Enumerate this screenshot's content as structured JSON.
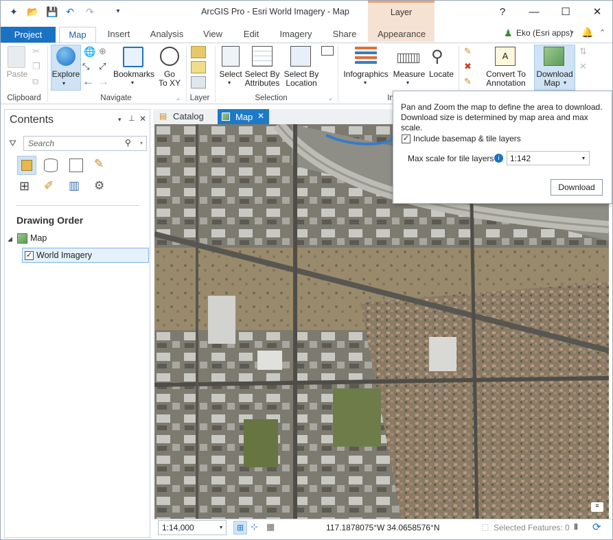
{
  "titlebar": {
    "title": "ArcGIS Pro - Esri World Imagery - Map",
    "context_group": "Layer",
    "help": "?",
    "min": "—",
    "max": "☐",
    "close": "✕"
  },
  "tabs": {
    "project": "Project",
    "items": [
      "Map",
      "Insert",
      "Analysis",
      "View",
      "Edit",
      "Imagery",
      "Share"
    ],
    "context_tab": "Appearance",
    "user": "Eko (Esri apps)"
  },
  "ribbon": {
    "clipboard": {
      "label": "Clipboard",
      "paste": "Paste"
    },
    "navigate": {
      "label": "Navigate",
      "explore": "Explore",
      "bookmarks": "Bookmarks",
      "goto_line1": "Go",
      "goto_line2": "To XY"
    },
    "layer": {
      "label": "Layer"
    },
    "selection": {
      "label": "Selection",
      "select": "Select",
      "by_attr_1": "Select By",
      "by_attr_2": "Attributes",
      "by_loc_1": "Select By",
      "by_loc_2": "Location"
    },
    "inquiry": {
      "label": "In",
      "infographics": "Infographics",
      "measure": "Measure",
      "locate": "Locate"
    },
    "labeling": {
      "convert_1": "Convert To",
      "convert_2": "Annotation"
    },
    "offline": {
      "download_1": "Download",
      "download_2": "Map"
    }
  },
  "contents": {
    "title": "Contents",
    "search_placeholder": "Search",
    "section": "Drawing Order",
    "tree": {
      "map": "Map",
      "layer": "World Imagery"
    }
  },
  "view_tabs": {
    "catalog": "Catalog",
    "map": "Map"
  },
  "popup": {
    "line1": "Pan and Zoom  the map to define the area to download.",
    "line2": "Download size is determined by map area and max scale.",
    "include_label": "Include basemap & tile layers",
    "include_checked": true,
    "max_scale_label": "Max scale for tile layers",
    "max_scale_value": "1:142",
    "download": "Download"
  },
  "status": {
    "scale": "1:14,000",
    "coords": "117.1878075°W 34.0658576°N",
    "selected": "Selected Features: 0"
  },
  "colors": {
    "accent": "#1a72c5",
    "context": "#f6e2d2"
  }
}
